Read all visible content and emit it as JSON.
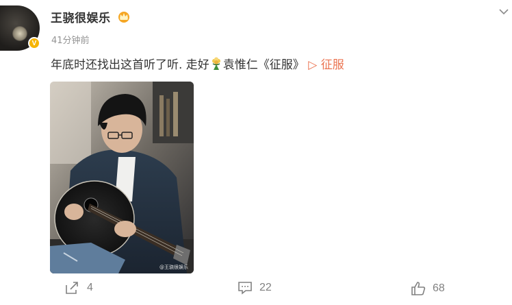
{
  "author": {
    "name": "王骁很娱乐",
    "verified_badge": "V",
    "time": "41分钟前"
  },
  "post": {
    "text": "年底时还找出这首听了听. 走好",
    "emoji": "flower-bouquet",
    "text_after_emoji": "袁惟仁《征服》",
    "link_label": "▷ 征服"
  },
  "image": {
    "watermark": "@王骁很娱乐"
  },
  "actions": {
    "repost_count": "4",
    "comment_count": "22",
    "like_count": "68"
  },
  "colors": {
    "link": "#eb7350",
    "muted": "#939393",
    "badge": "#f7b500"
  }
}
